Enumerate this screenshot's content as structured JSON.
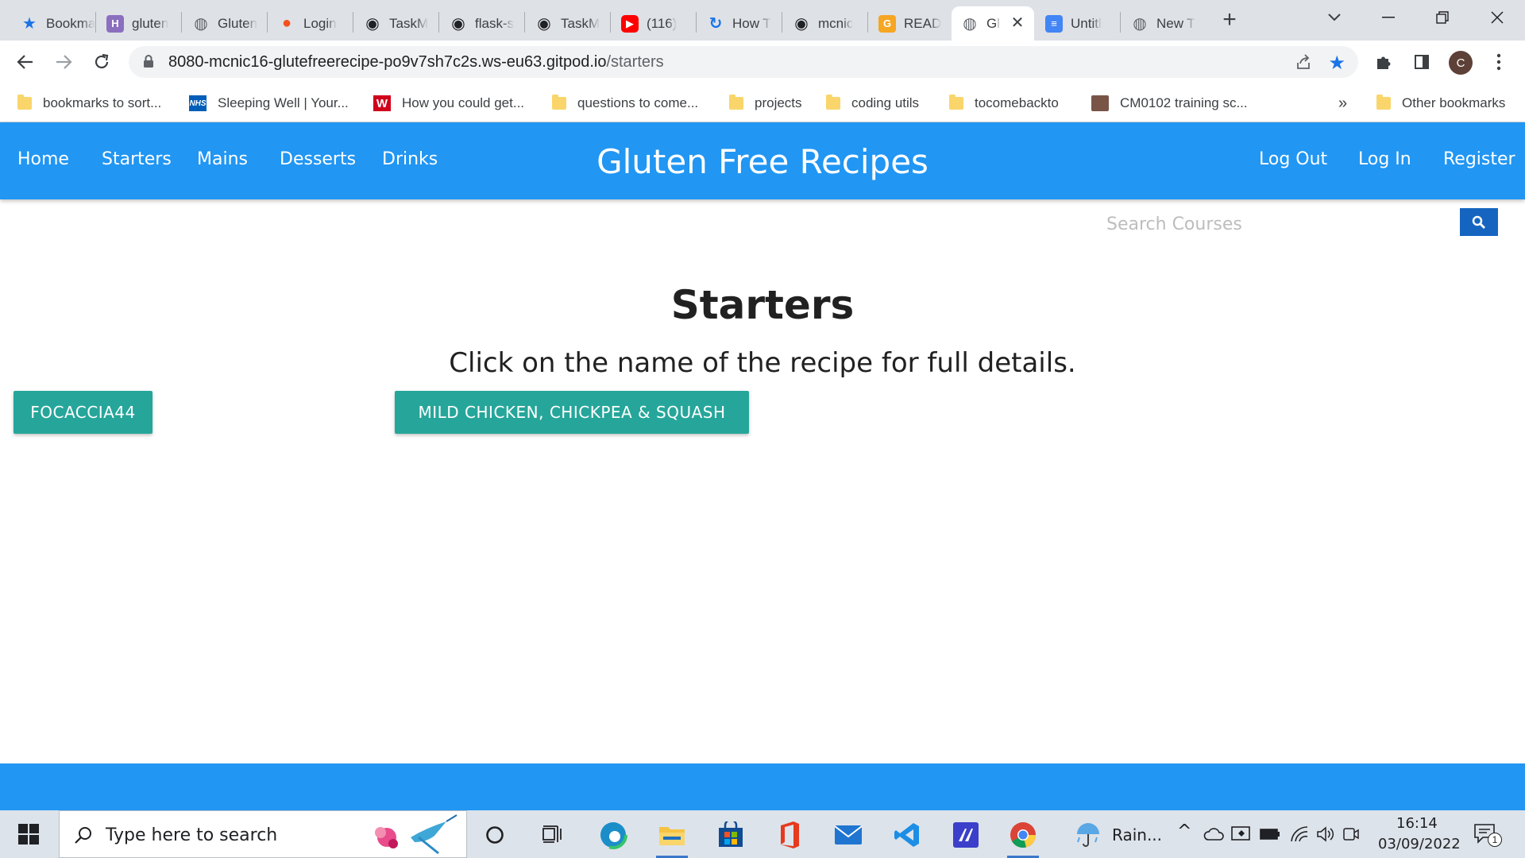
{
  "browser": {
    "tabs": [
      {
        "title": "Bookmarks",
        "icon": "bookmark-star-icon",
        "color": "#1a73e8"
      },
      {
        "title": "gluten",
        "icon": "heroku-icon",
        "color": "#8b6fbf"
      },
      {
        "title": "Gluten",
        "icon": "globe-icon",
        "color": "#5f6368"
      },
      {
        "title": "Login",
        "icon": "circle-icon",
        "color": "#f4511e"
      },
      {
        "title": "TaskM",
        "icon": "github-icon",
        "color": "#202124"
      },
      {
        "title": "flask-s",
        "icon": "github-icon",
        "color": "#202124"
      },
      {
        "title": "TaskM",
        "icon": "github-icon",
        "color": "#202124"
      },
      {
        "title": "(116)",
        "icon": "youtube-icon",
        "color": "#ff0000"
      },
      {
        "title": "How T",
        "icon": "refresh-icon",
        "color": "#1a73e8"
      },
      {
        "title": "mcnic",
        "icon": "github-icon",
        "color": "#202124"
      },
      {
        "title": "READ",
        "icon": "gitpod-icon",
        "color": "#f5a623"
      },
      {
        "title": "Gl",
        "icon": "globe-icon",
        "color": "#5f6368",
        "active": true
      },
      {
        "title": "Untitl",
        "icon": "docs-icon",
        "color": "#4285f4"
      },
      {
        "title": "New T",
        "icon": "chrome-icon",
        "color": "#5f6368"
      }
    ],
    "url_host": "8080-mcnic16-glutefreerecipe-po9v7sh7c2s.ws-eu63.gitpod.io",
    "url_path": "/starters",
    "profile_initial": "C",
    "bookmarks": [
      {
        "label": "bookmarks to sort...",
        "icon": "folder-icon"
      },
      {
        "label": "Sleeping Well | Your...",
        "icon": "nhs-icon",
        "badge": "NHS"
      },
      {
        "label": "How you could get...",
        "icon": "w-icon",
        "badge": "W"
      },
      {
        "label": "questions to come...",
        "icon": "folder-icon"
      },
      {
        "label": "projects",
        "icon": "folder-icon"
      },
      {
        "label": "coding utils",
        "icon": "folder-icon"
      },
      {
        "label": "tocomebackto",
        "icon": "folder-icon"
      },
      {
        "label": "CM0102 training sc...",
        "icon": "page-icon"
      }
    ],
    "overflow_label": "»",
    "other_bookmarks": "Other bookmarks"
  },
  "site": {
    "nav_left": [
      "Home",
      "Starters",
      "Mains",
      "Desserts",
      "Drinks"
    ],
    "brand": "Gluten Free Recipes",
    "nav_right": [
      "Log Out",
      "Log In",
      "Register"
    ],
    "search_placeholder": "Search Courses",
    "page_title": "Starters",
    "subtitle": "Click on the name of the recipe for full details.",
    "recipes": [
      "focaccia44",
      "Mild chicken, chickpea & squash"
    ],
    "colors": {
      "primary": "#2196f3",
      "button": "#26a69a",
      "search_button": "#1565c0"
    }
  },
  "taskbar": {
    "search_placeholder": "Type here to search",
    "weather": "Rain...",
    "time": "16:14",
    "date": "03/09/2022",
    "notification_count": "1"
  }
}
